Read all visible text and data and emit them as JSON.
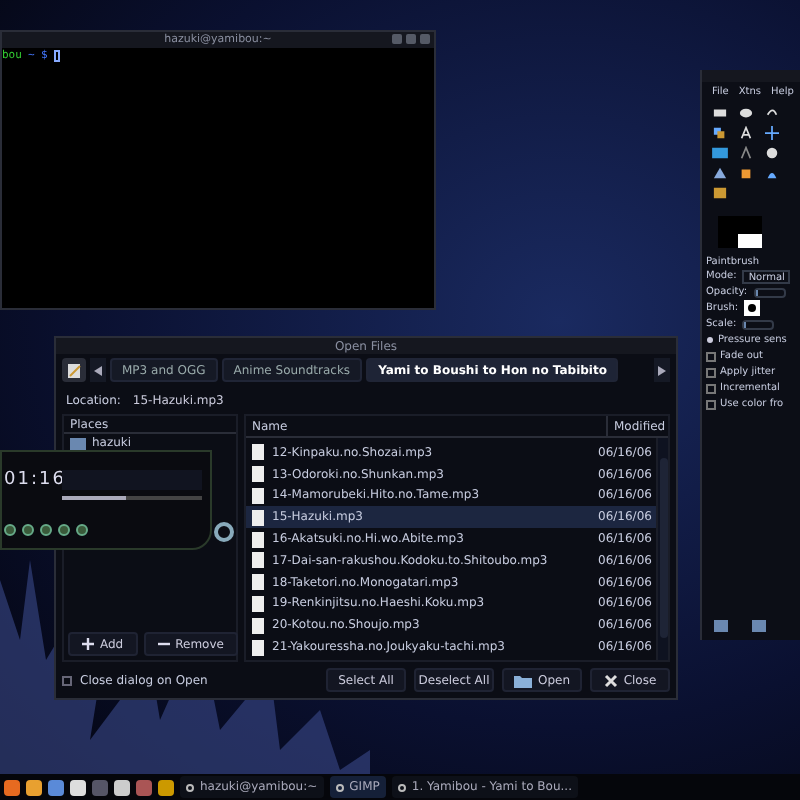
{
  "terminal": {
    "title": "hazuki@yamibou:~",
    "prompt_user": "bou",
    "prompt_path": "~ $"
  },
  "gimp": {
    "menu": [
      "File",
      "Xtns",
      "Help"
    ],
    "tool_name": "Paintbrush",
    "options": [
      {
        "kind": "dropdown",
        "label": "Mode:",
        "value": "Normal"
      },
      {
        "kind": "bar",
        "label": "Opacity:",
        "level": 0
      },
      {
        "kind": "brush",
        "label": "Brush:"
      },
      {
        "kind": "bar",
        "label": "Scale:",
        "level": 0
      }
    ],
    "expander": "Pressure sens",
    "checks": [
      {
        "label": "Fade out",
        "checked": false
      },
      {
        "label": "Apply jitter",
        "checked": false
      },
      {
        "label": "Incremental",
        "checked": false
      },
      {
        "label": "Use color fro",
        "checked": false
      }
    ]
  },
  "player": {
    "time": "01:16",
    "level": 0.45
  },
  "dialog": {
    "title": "Open Files",
    "path": [
      {
        "label": "MP3 and OGG",
        "selected": false
      },
      {
        "label": "Anime Soundtracks",
        "selected": false
      },
      {
        "label": "Yami to Boushi to Hon no Tabibito",
        "selected": true
      }
    ],
    "location_label": "Location:",
    "location": "15-Hazuki.mp3",
    "places_header": "Places",
    "places": [
      {
        "name": "hazuki"
      }
    ],
    "columns": [
      "Name",
      "Modified"
    ],
    "files": [
      {
        "name": "12-Kinpaku.no.Shozai.mp3",
        "modified": "06/16/06",
        "selected": false
      },
      {
        "name": "13-Odoroki.no.Shunkan.mp3",
        "modified": "06/16/06",
        "selected": false
      },
      {
        "name": "14-Mamorubeki.Hito.no.Tame.mp3",
        "modified": "06/16/06",
        "selected": false
      },
      {
        "name": "15-Hazuki.mp3",
        "modified": "06/16/06",
        "selected": true
      },
      {
        "name": "16-Akatsuki.no.Hi.wo.Abite.mp3",
        "modified": "06/16/06",
        "selected": false
      },
      {
        "name": "17-Dai-san-rakushou.Kodoku.to.Shitoubo.mp3",
        "modified": "06/16/06",
        "selected": false
      },
      {
        "name": "18-Taketori.no.Monogatari.mp3",
        "modified": "06/16/06",
        "selected": false
      },
      {
        "name": "19-Renkinjitsu.no.Haeshi.Koku.mp3",
        "modified": "06/16/06",
        "selected": false
      },
      {
        "name": "20-Kotou.no.Shoujo.mp3",
        "modified": "06/16/06",
        "selected": false
      },
      {
        "name": "21-Yakouressha.no.Joukyaku-tachi.mp3",
        "modified": "06/16/06",
        "selected": false
      }
    ],
    "add": "Add",
    "remove": "Remove",
    "close_on_open": {
      "label": "Close dialog on Open",
      "checked": false
    },
    "actions": [
      {
        "kind": "plain",
        "label": "Select All"
      },
      {
        "kind": "plain",
        "label": "Deselect All"
      },
      {
        "kind": "open",
        "label": "Open"
      },
      {
        "kind": "close",
        "label": "Close"
      }
    ]
  },
  "taskbar": {
    "tasks": [
      {
        "label": "hazuki@yamibou:~",
        "selected": false
      },
      {
        "label": "GIMP",
        "selected": true
      },
      {
        "label": "1. Yamibou - Yami to Bou...",
        "selected": false
      }
    ]
  }
}
